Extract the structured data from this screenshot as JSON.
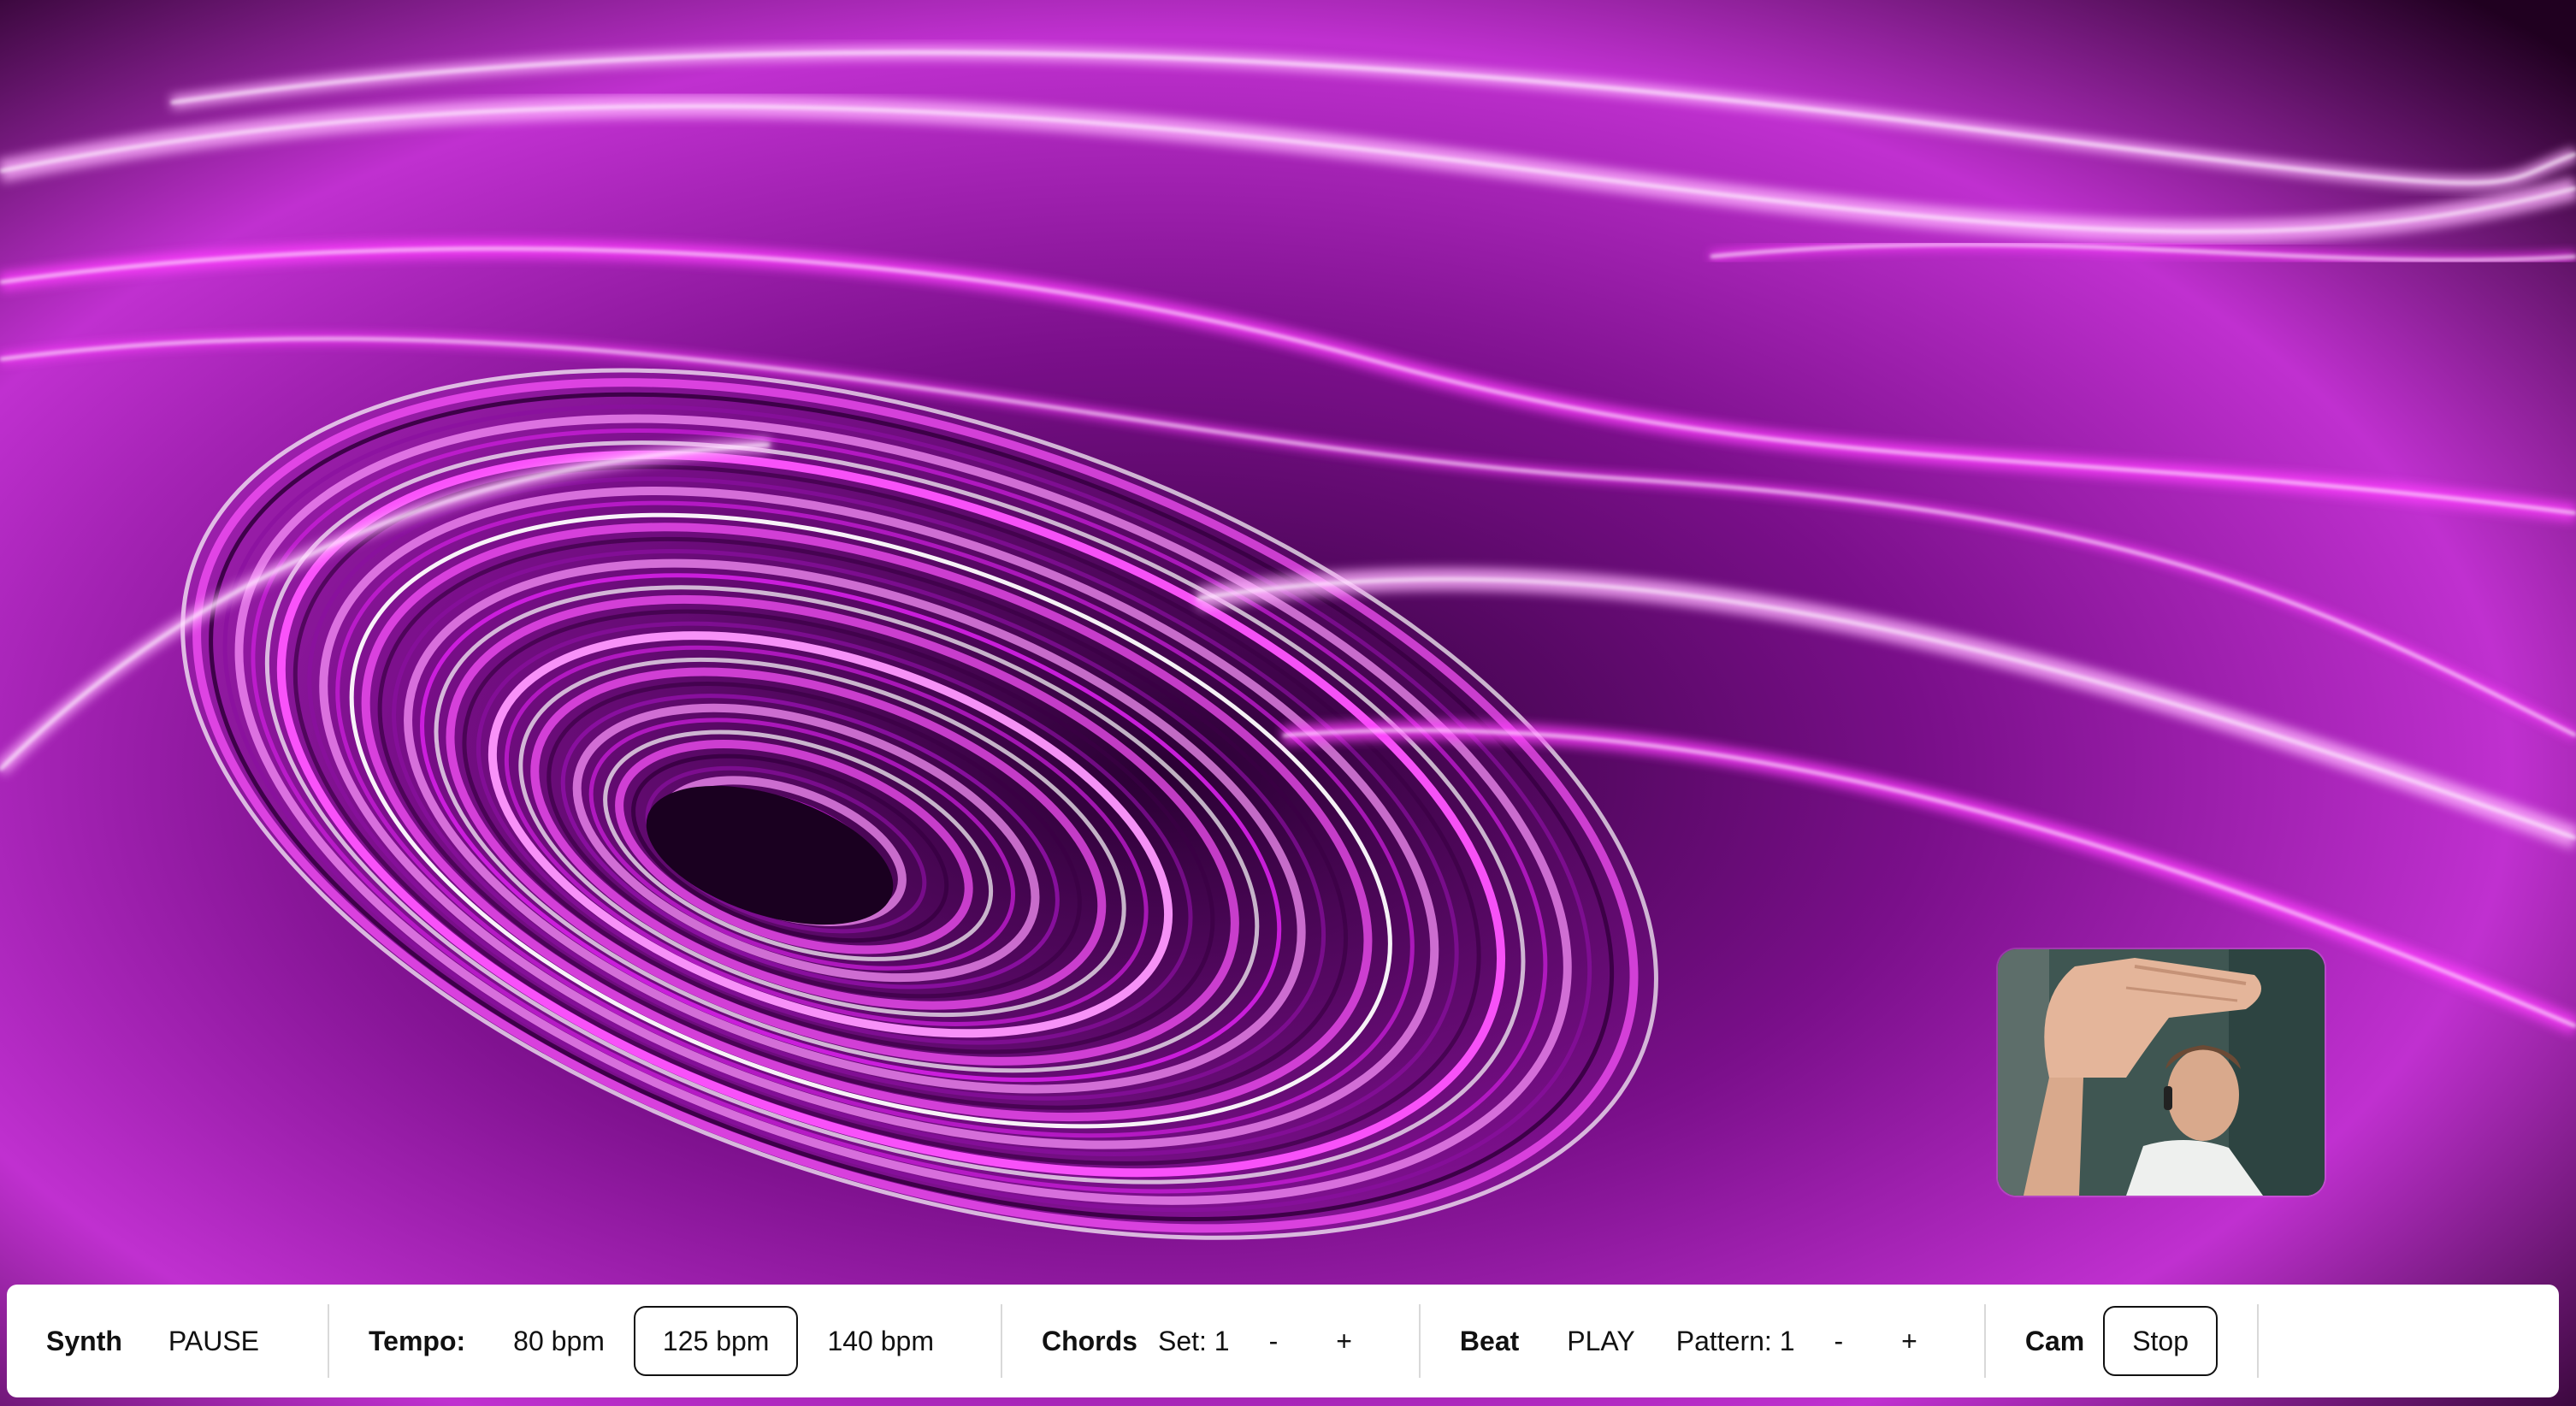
{
  "controls": {
    "synth": {
      "label": "Synth",
      "toggle": "PAUSE"
    },
    "tempo": {
      "label": "Tempo:",
      "options": [
        "80 bpm",
        "125 bpm",
        "140 bpm"
      ],
      "selected": "125 bpm"
    },
    "chords": {
      "label": "Chords",
      "set": "Set: 1",
      "minus": "-",
      "plus": "+"
    },
    "beat": {
      "label": "Beat",
      "toggle": "PLAY",
      "pattern": "Pattern: 1",
      "minus": "-",
      "plus": "+"
    },
    "cam": {
      "label": "Cam",
      "button": "Stop"
    }
  },
  "colors": {
    "fluid_primary": "#ff44ff",
    "fluid_dark": "#1a0020",
    "bar_background": "#ffffff"
  }
}
